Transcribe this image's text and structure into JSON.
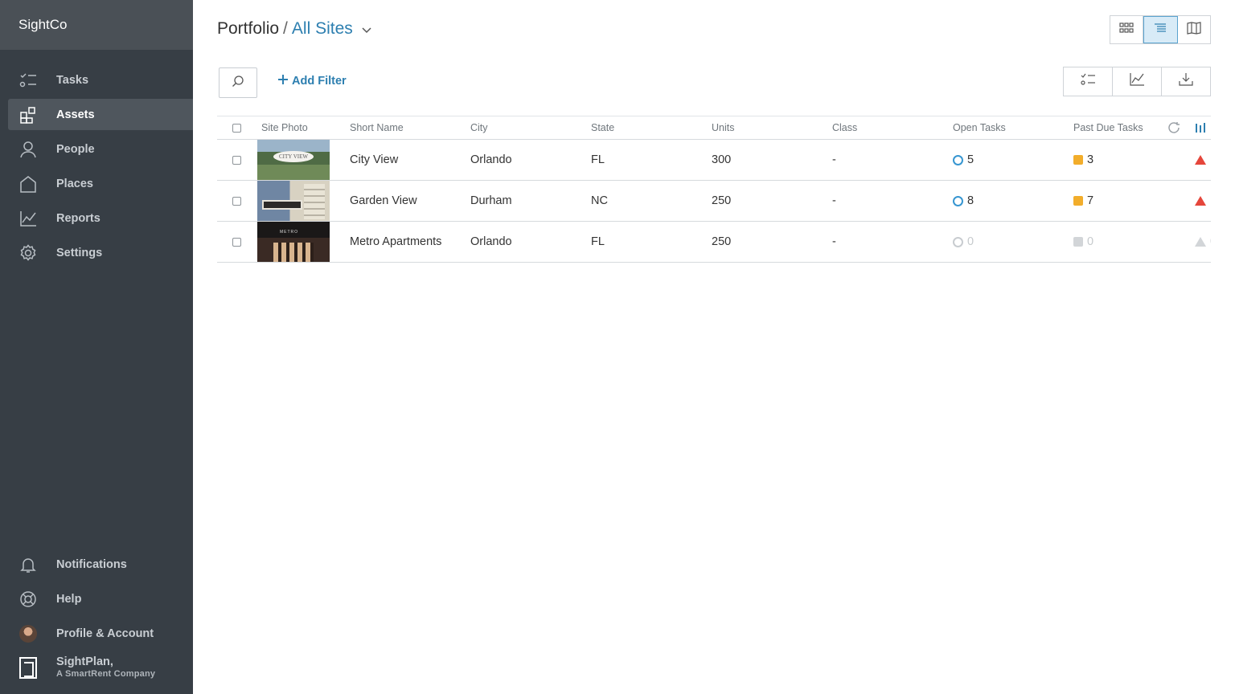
{
  "app": {
    "name": "SightCo"
  },
  "sidebar": {
    "items": [
      {
        "label": "Tasks",
        "icon": "tasks-icon"
      },
      {
        "label": "Assets",
        "icon": "assets-icon",
        "active": true
      },
      {
        "label": "People",
        "icon": "person-icon"
      },
      {
        "label": "Places",
        "icon": "house-icon"
      },
      {
        "label": "Reports",
        "icon": "chart-icon"
      },
      {
        "label": "Settings",
        "icon": "gear-icon"
      }
    ],
    "bottom": [
      {
        "label": "Notifications",
        "icon": "bell-icon"
      },
      {
        "label": "Help",
        "icon": "lifebuoy-icon"
      },
      {
        "label": "Profile & Account",
        "icon": "avatar"
      }
    ],
    "company": {
      "line1": "SightPlan,",
      "line2": "A SmartRent Company"
    }
  },
  "header": {
    "title": "Portfolio",
    "separator": "/",
    "selector": "All Sites",
    "view_modes": [
      "grid",
      "list",
      "map"
    ],
    "active_view": "list"
  },
  "toolbar": {
    "add_filter_label": "Add Filter",
    "tools": [
      "checklist-icon",
      "chart-icon",
      "download-icon"
    ]
  },
  "table": {
    "columns": [
      "Site Photo",
      "Short Name",
      "City",
      "State",
      "Units",
      "Class",
      "Open Tasks",
      "Past Due Tasks"
    ],
    "rows": [
      {
        "name": "City View",
        "city": "Orlando",
        "state": "FL",
        "units": "300",
        "class": "-",
        "open_tasks": "5",
        "past_due": "3",
        "alerts": "1",
        "photo_sign": "CITY VIEW"
      },
      {
        "name": "Garden View",
        "city": "Durham",
        "state": "NC",
        "units": "250",
        "class": "-",
        "open_tasks": "8",
        "past_due": "7",
        "alerts": "1",
        "photo_sign": ""
      },
      {
        "name": "Metro Apartments",
        "city": "Orlando",
        "state": "FL",
        "units": "250",
        "class": "-",
        "open_tasks": "0",
        "past_due": "0",
        "alerts": "0",
        "photo_sign": "METRO"
      }
    ]
  },
  "colors": {
    "sidebar_bg": "#373e45",
    "accent": "#2d7fb0",
    "open_task": "#3796d1",
    "past_due": "#f2ad2b",
    "alert": "#e5463b"
  }
}
